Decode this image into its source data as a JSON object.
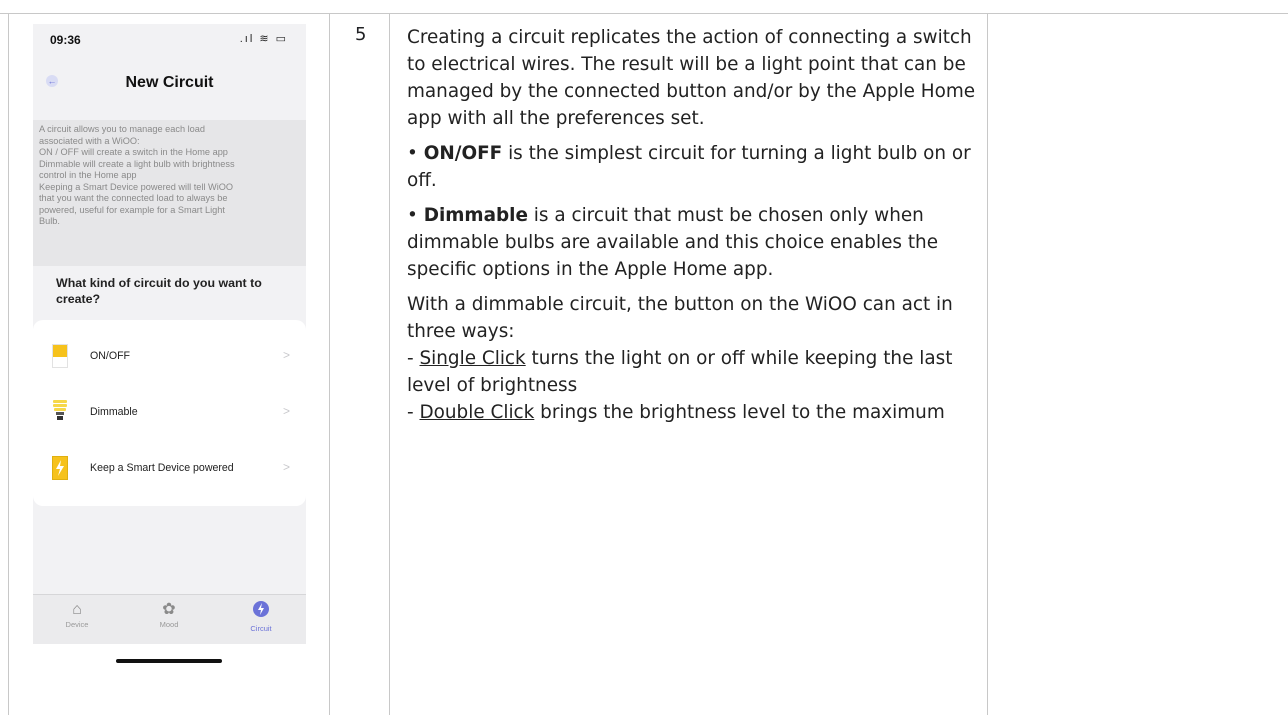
{
  "row_number": "5",
  "phone": {
    "status_time": "09:36",
    "status_icons": ".ıl ≋ ▭",
    "back_icon": "←",
    "title": "New Circuit",
    "info_text": "A circuit allows you to manage each load\nassociated with a WiOO:\nON / OFF will create a switch in the Home app\nDimmable will create a light bulb with brightness\ncontrol in the Home app\nKeeping a Smart Device powered will tell WiOO\nthat you want the connected load to always be\npowered, useful for example for a Smart Light\nBulb.",
    "question": "What kind of circuit do you want to create?",
    "options": [
      {
        "label": "ON/OFF",
        "icon": "switch-icon"
      },
      {
        "label": "Dimmable",
        "icon": "light-bulb-icon"
      },
      {
        "label": "Keep a Smart Device powered",
        "icon": "power-bolt-icon"
      }
    ],
    "chevron": ">",
    "tabs": [
      {
        "label": "Device",
        "icon": "⌂",
        "icon_name": "house-icon"
      },
      {
        "label": "Mood",
        "icon": "✿",
        "icon_name": "palette-icon"
      },
      {
        "label": "Circuit",
        "icon": "ϟ",
        "icon_name": "bolt-icon"
      }
    ],
    "accent_color": "#6b72d8"
  },
  "description": {
    "intro": "Creating a circuit replicates the action of connecting a switch to electrical wires. The result will be a light point that can be managed by the connected button and/or by the Apple Home app with all the preferences set.",
    "onoff_bullet": "• ",
    "onoff_term": "ON/OFF",
    "onoff_text": " is the simplest circuit for turning a light bulb on or off.",
    "dimmable_bullet": "• ",
    "dimmable_term": "Dimmable",
    "dimmable_text": " is a circuit that must be chosen only when dimmable bulbs are available and this choice enables the specific options in the Apple Home app.",
    "modes_intro": "With a dimmable circuit, the button on the WiOO can act in three ways:",
    "single_prefix": "- ",
    "single_term": "Single Click",
    "single_text": " turns the light on or off while keeping the last level of brightness",
    "double_prefix": "- ",
    "double_term": "Double Click",
    "double_text": " brings the brightness level to the maximum"
  }
}
